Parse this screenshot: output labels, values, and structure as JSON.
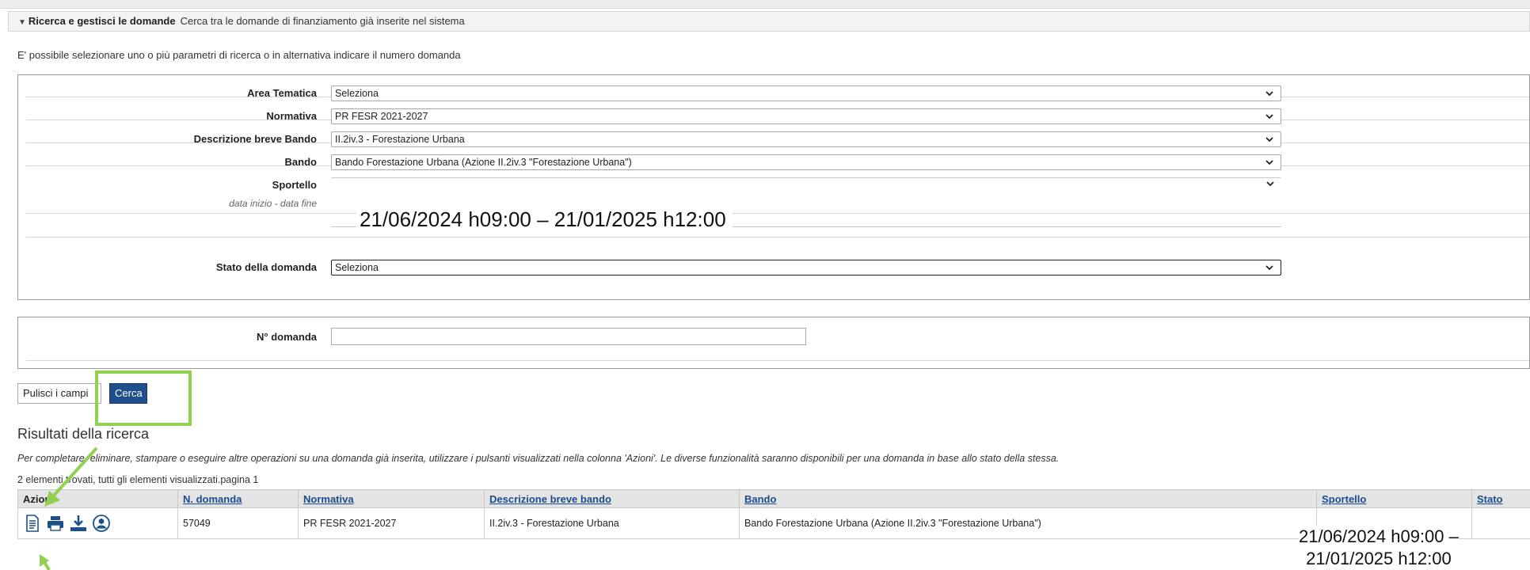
{
  "header": {
    "title": "Ricerca e gestisci le domande",
    "description": "Cerca tra le domande di finanziamento già inserite nel sistema",
    "close_mark": "˄"
  },
  "intro": "E' possibile selezionare uno o più parametri di ricerca o in alternativa indicare il numero domanda",
  "filters": {
    "area_tematica": {
      "label": "Area Tematica",
      "value": "Seleziona"
    },
    "normativa": {
      "label": "Normativa",
      "value": "PR FESR 2021-2027"
    },
    "descrizione_breve_bando": {
      "label": "Descrizione breve Bando",
      "value": "II.2iv.3 - Forestazione Urbana"
    },
    "bando": {
      "label": "Bando",
      "value": "Bando Forestazione Urbana (Azione II.2iv.3 \"Forestazione Urbana\")"
    },
    "sportello": {
      "label": "Sportello",
      "sublabel": "data inizio - data fine",
      "value": "21/06/2024 h09:00 – 21/01/2025 h12:00"
    },
    "stato_domanda": {
      "label": "Stato della domanda",
      "value": "Seleziona"
    },
    "numero_domanda": {
      "label": "N° domanda",
      "value": ""
    }
  },
  "buttons": {
    "clear": "Pulisci i campi",
    "search": "Cerca"
  },
  "results": {
    "title": "Risultati della ricerca",
    "note": "Per completare, eliminare, stampare o eseguire altre operazioni su una domanda già inserita, utilizzare i pulsanti visualizzati nella colonna 'Azioni'. Le diverse funzionalità saranno disponibili per una domanda in base allo stato della stessa.",
    "count": "2 elementi trovati, tutti gli elementi visualizzati.pagina 1",
    "columns": [
      "Azioni",
      "N. domanda",
      "Normativa",
      "Descrizione breve bando",
      "Bando",
      "Sportello",
      "Stato"
    ],
    "rows": [
      {
        "numero": "57049",
        "normativa": "PR FESR 2021-2027",
        "descrizione": "II.2iv.3 - Forestazione Urbana",
        "bando": "Bando Forestazione Urbana (Azione II.2iv.3 \"Forestazione Urbana\")",
        "sportello_line1": "21/06/2024 h09:00 –",
        "sportello_line2": "21/01/2025 h12:00",
        "stato": ""
      }
    ],
    "action_icons": [
      "document-icon",
      "print-icon",
      "download-icon",
      "user-icon"
    ]
  },
  "colors": {
    "accent": "#1f4f8a",
    "highlight": "#92d050",
    "link": "#1a4d8f"
  }
}
